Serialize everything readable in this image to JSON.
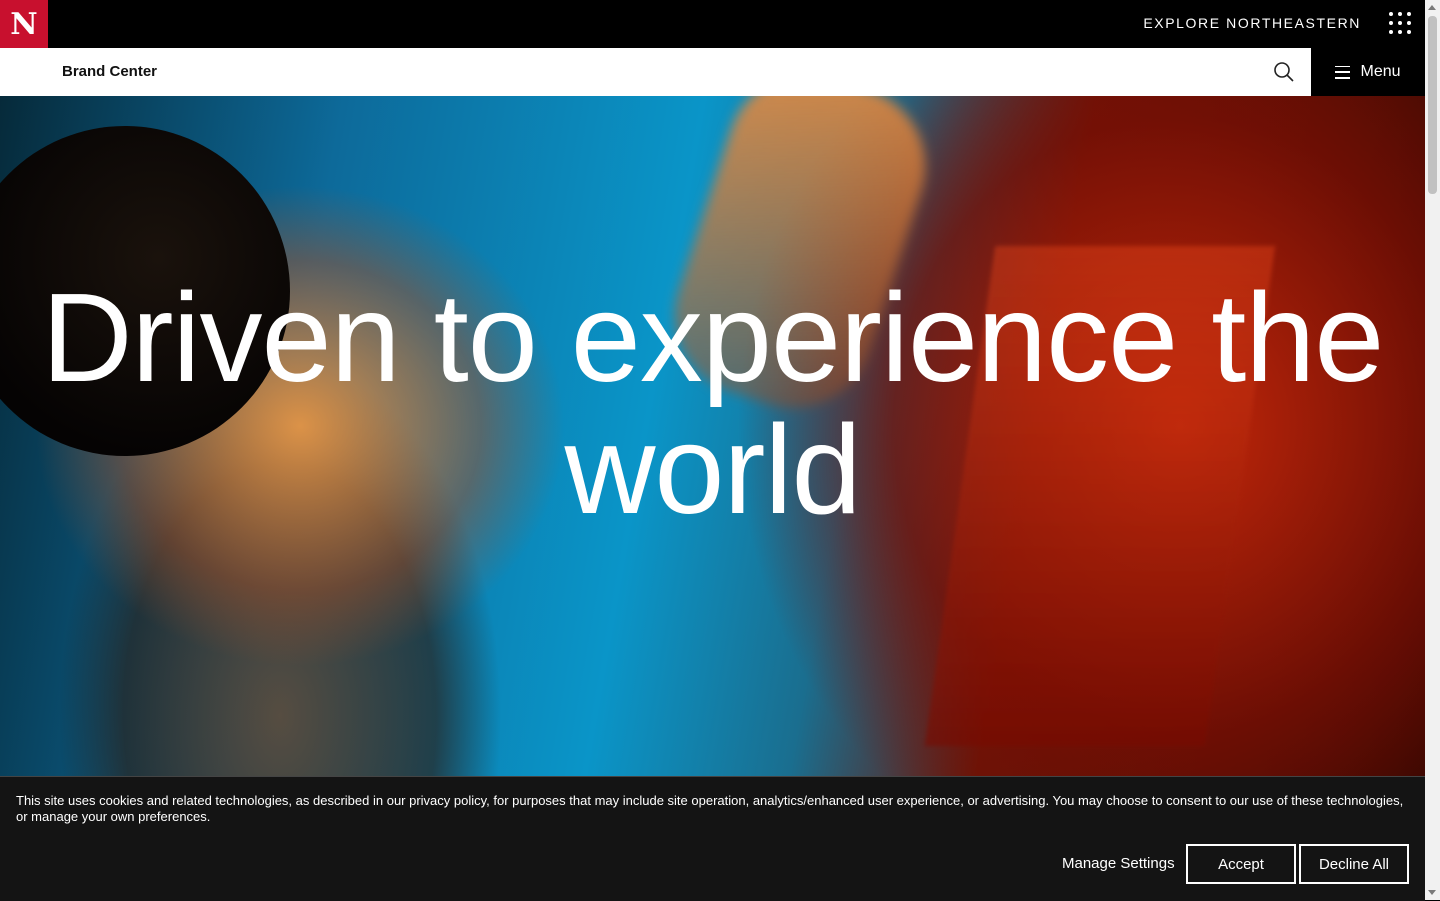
{
  "header": {
    "logo_letter": "N",
    "explore_label": "EXPLORE NORTHEASTERN",
    "site_name": "Brand Center",
    "menu_label": "Menu",
    "accent_color": "#c8102e"
  },
  "hero": {
    "headline": "Driven to experience the world"
  },
  "cookie_banner": {
    "text": "This site uses cookies and related technologies, as described in our privacy policy, for purposes that may include site operation, analytics/enhanced user experience, or advertising. You may choose to consent to our use of these technologies, or manage your own preferences.",
    "manage_label": "Manage Settings",
    "accept_label": "Accept",
    "decline_label": "Decline All"
  },
  "icons": {
    "logo": "northeastern-n-logo-icon",
    "apps": "apps-grid-icon",
    "search": "search-icon",
    "menu": "hamburger-icon"
  }
}
